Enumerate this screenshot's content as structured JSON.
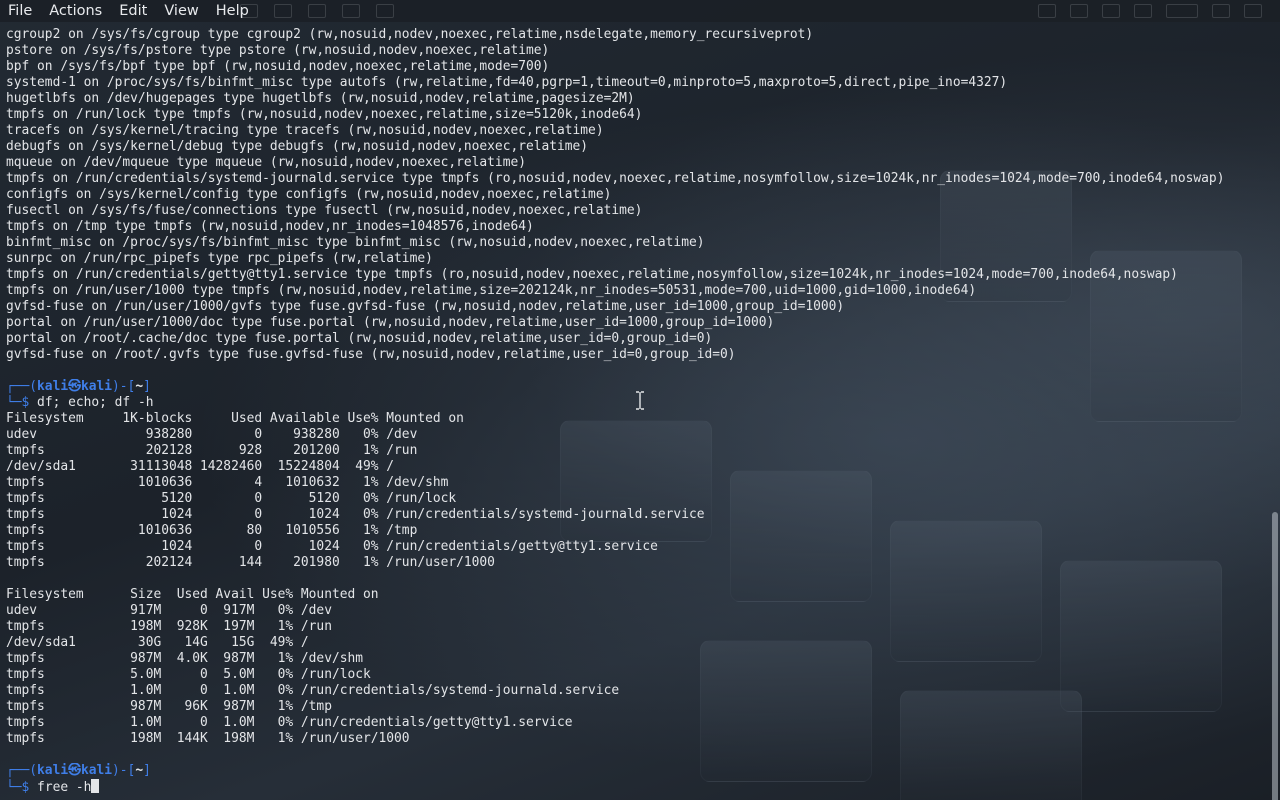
{
  "menu": {
    "file": "File",
    "actions": "Actions",
    "edit": "Edit",
    "view": "View",
    "help": "Help"
  },
  "colors": {
    "background": "#1b2129",
    "text": "#e3e5e8",
    "prompt_blue": "#3f7ee8"
  },
  "mount_output": [
    "cgroup2 on /sys/fs/cgroup type cgroup2 (rw,nosuid,nodev,noexec,relatime,nsdelegate,memory_recursiveprot)",
    "pstore on /sys/fs/pstore type pstore (rw,nosuid,nodev,noexec,relatime)",
    "bpf on /sys/fs/bpf type bpf (rw,nosuid,nodev,noexec,relatime,mode=700)",
    "systemd-1 on /proc/sys/fs/binfmt_misc type autofs (rw,relatime,fd=40,pgrp=1,timeout=0,minproto=5,maxproto=5,direct,pipe_ino=4327)",
    "hugetlbfs on /dev/hugepages type hugetlbfs (rw,nosuid,nodev,relatime,pagesize=2M)",
    "tmpfs on /run/lock type tmpfs (rw,nosuid,nodev,noexec,relatime,size=5120k,inode64)",
    "tracefs on /sys/kernel/tracing type tracefs (rw,nosuid,nodev,noexec,relatime)",
    "debugfs on /sys/kernel/debug type debugfs (rw,nosuid,nodev,noexec,relatime)",
    "mqueue on /dev/mqueue type mqueue (rw,nosuid,nodev,noexec,relatime)",
    "tmpfs on /run/credentials/systemd-journald.service type tmpfs (ro,nosuid,nodev,noexec,relatime,nosymfollow,size=1024k,nr_inodes=1024,mode=700,inode64,noswap)",
    "configfs on /sys/kernel/config type configfs (rw,nosuid,nodev,noexec,relatime)",
    "fusectl on /sys/fs/fuse/connections type fusectl (rw,nosuid,nodev,noexec,relatime)",
    "tmpfs on /tmp type tmpfs (rw,nosuid,nodev,nr_inodes=1048576,inode64)",
    "binfmt_misc on /proc/sys/fs/binfmt_misc type binfmt_misc (rw,nosuid,nodev,noexec,relatime)",
    "sunrpc on /run/rpc_pipefs type rpc_pipefs (rw,relatime)",
    "tmpfs on /run/credentials/getty@tty1.service type tmpfs (ro,nosuid,nodev,noexec,relatime,nosymfollow,size=1024k,nr_inodes=1024,mode=700,inode64,noswap)",
    "tmpfs on /run/user/1000 type tmpfs (rw,nosuid,nodev,relatime,size=202124k,nr_inodes=50531,mode=700,uid=1000,gid=1000,inode64)",
    "gvfsd-fuse on /run/user/1000/gvfs type fuse.gvfsd-fuse (rw,nosuid,nodev,relatime,user_id=1000,group_id=1000)",
    "portal on /run/user/1000/doc type fuse.portal (rw,nosuid,nodev,relatime,user_id=1000,group_id=1000)",
    "portal on /root/.cache/doc type fuse.portal (rw,nosuid,nodev,relatime,user_id=0,group_id=0)",
    "gvfsd-fuse on /root/.gvfs type fuse.gvfsd-fuse (rw,nosuid,nodev,relatime,user_id=0,group_id=0)"
  ],
  "prompt1": {
    "top_left": "┌──(",
    "user_host": "kali㉿kali",
    "top_mid": ")-[",
    "dir": "~",
    "top_right": "]",
    "bottom": "└─$",
    "command": " df; echo; df -h"
  },
  "df_output": [
    "Filesystem     1K-blocks     Used Available Use% Mounted on",
    "udev              938280        0    938280   0% /dev",
    "tmpfs             202128      928    201200   1% /run",
    "/dev/sda1       31113048 14282460  15224804  49% /",
    "tmpfs            1010636        4   1010632   1% /dev/shm",
    "tmpfs               5120        0      5120   0% /run/lock",
    "tmpfs               1024        0      1024   0% /run/credentials/systemd-journald.service",
    "tmpfs            1010636       80   1010556   1% /tmp",
    "tmpfs               1024        0      1024   0% /run/credentials/getty@tty1.service",
    "tmpfs             202124      144    201980   1% /run/user/1000"
  ],
  "dfh_output": [
    "Filesystem      Size  Used Avail Use% Mounted on",
    "udev            917M     0  917M   0% /dev",
    "tmpfs           198M  928K  197M   1% /run",
    "/dev/sda1        30G   14G   15G  49% /",
    "tmpfs           987M  4.0K  987M   1% /dev/shm",
    "tmpfs           5.0M     0  5.0M   0% /run/lock",
    "tmpfs           1.0M     0  1.0M   0% /run/credentials/systemd-journald.service",
    "tmpfs           987M   96K  987M   1% /tmp",
    "tmpfs           1.0M     0  1.0M   0% /run/credentials/getty@tty1.service",
    "tmpfs           198M  144K  198M   1% /run/user/1000"
  ],
  "prompt2": {
    "top_left": "┌──(",
    "user_host": "kali㉿kali",
    "top_mid": ")-[",
    "dir": "~",
    "top_right": "]",
    "bottom": "└─$",
    "command": " free -h"
  }
}
